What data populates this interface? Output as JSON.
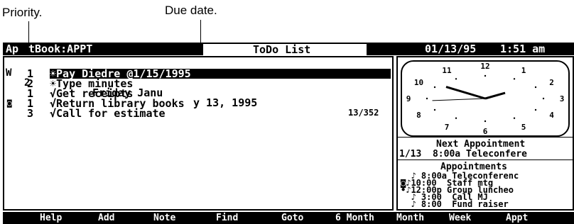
{
  "callouts": {
    "priority": "Priority.",
    "due_date": "Due date."
  },
  "titlebar": {
    "app": "Ap",
    "app_rest": "tBook:APPT",
    "title": "ToDo List",
    "date": "01/13/95",
    "time": "1:51 am"
  },
  "header": {
    "w": "W",
    "num": "2",
    "date_left": "Friday Janu",
    "date_right": "y 13, 1995",
    "count": "13/352"
  },
  "todos": [
    {
      "priority": "1",
      "mark": "☀",
      "text": "Pay Diedre @1/15/1995",
      "note": ""
    },
    {
      "priority": "2",
      "mark": "☀",
      "text": "Type minutes",
      "note": ""
    },
    {
      "priority": "1",
      "mark": "√",
      "text": "Get receipts",
      "note": ""
    },
    {
      "priority": "1",
      "mark": "√",
      "text": "Return library books",
      "note": "◙"
    },
    {
      "priority": "3",
      "mark": "√",
      "text": "Call for estimate",
      "note": ""
    }
  ],
  "clock": {
    "numerals": [
      "12",
      "1",
      "2",
      "3",
      "4",
      "5",
      "6",
      "7",
      "8",
      "9",
      "10",
      "11"
    ],
    "hour": 1,
    "minute": 51
  },
  "next_appointment": {
    "label": "Next Appointment",
    "value": "1/13  8:00a Teleconfere"
  },
  "appointments": {
    "label": "Appointments",
    "items": [
      {
        "prefix": "  ♪",
        "time": " 8:00a",
        "text": "Teleconferenc"
      },
      {
        "prefix": "◙♪",
        "time": "10:00 ",
        "text": "Staff mtg"
      },
      {
        "prefix": "•♪",
        "time": "12:00p",
        "text": "Group luncheo"
      },
      {
        "prefix": "  ♪",
        "time": " 3:00 ",
        "text": "Call MJ"
      },
      {
        "prefix": "  ♪",
        "time": " 8:00 ",
        "text": "Fund raiser"
      }
    ]
  },
  "function_keys": [
    "Help",
    "Add",
    "Note",
    "Find",
    "Goto",
    "6 Month",
    "Month",
    "Week",
    "Appt"
  ]
}
